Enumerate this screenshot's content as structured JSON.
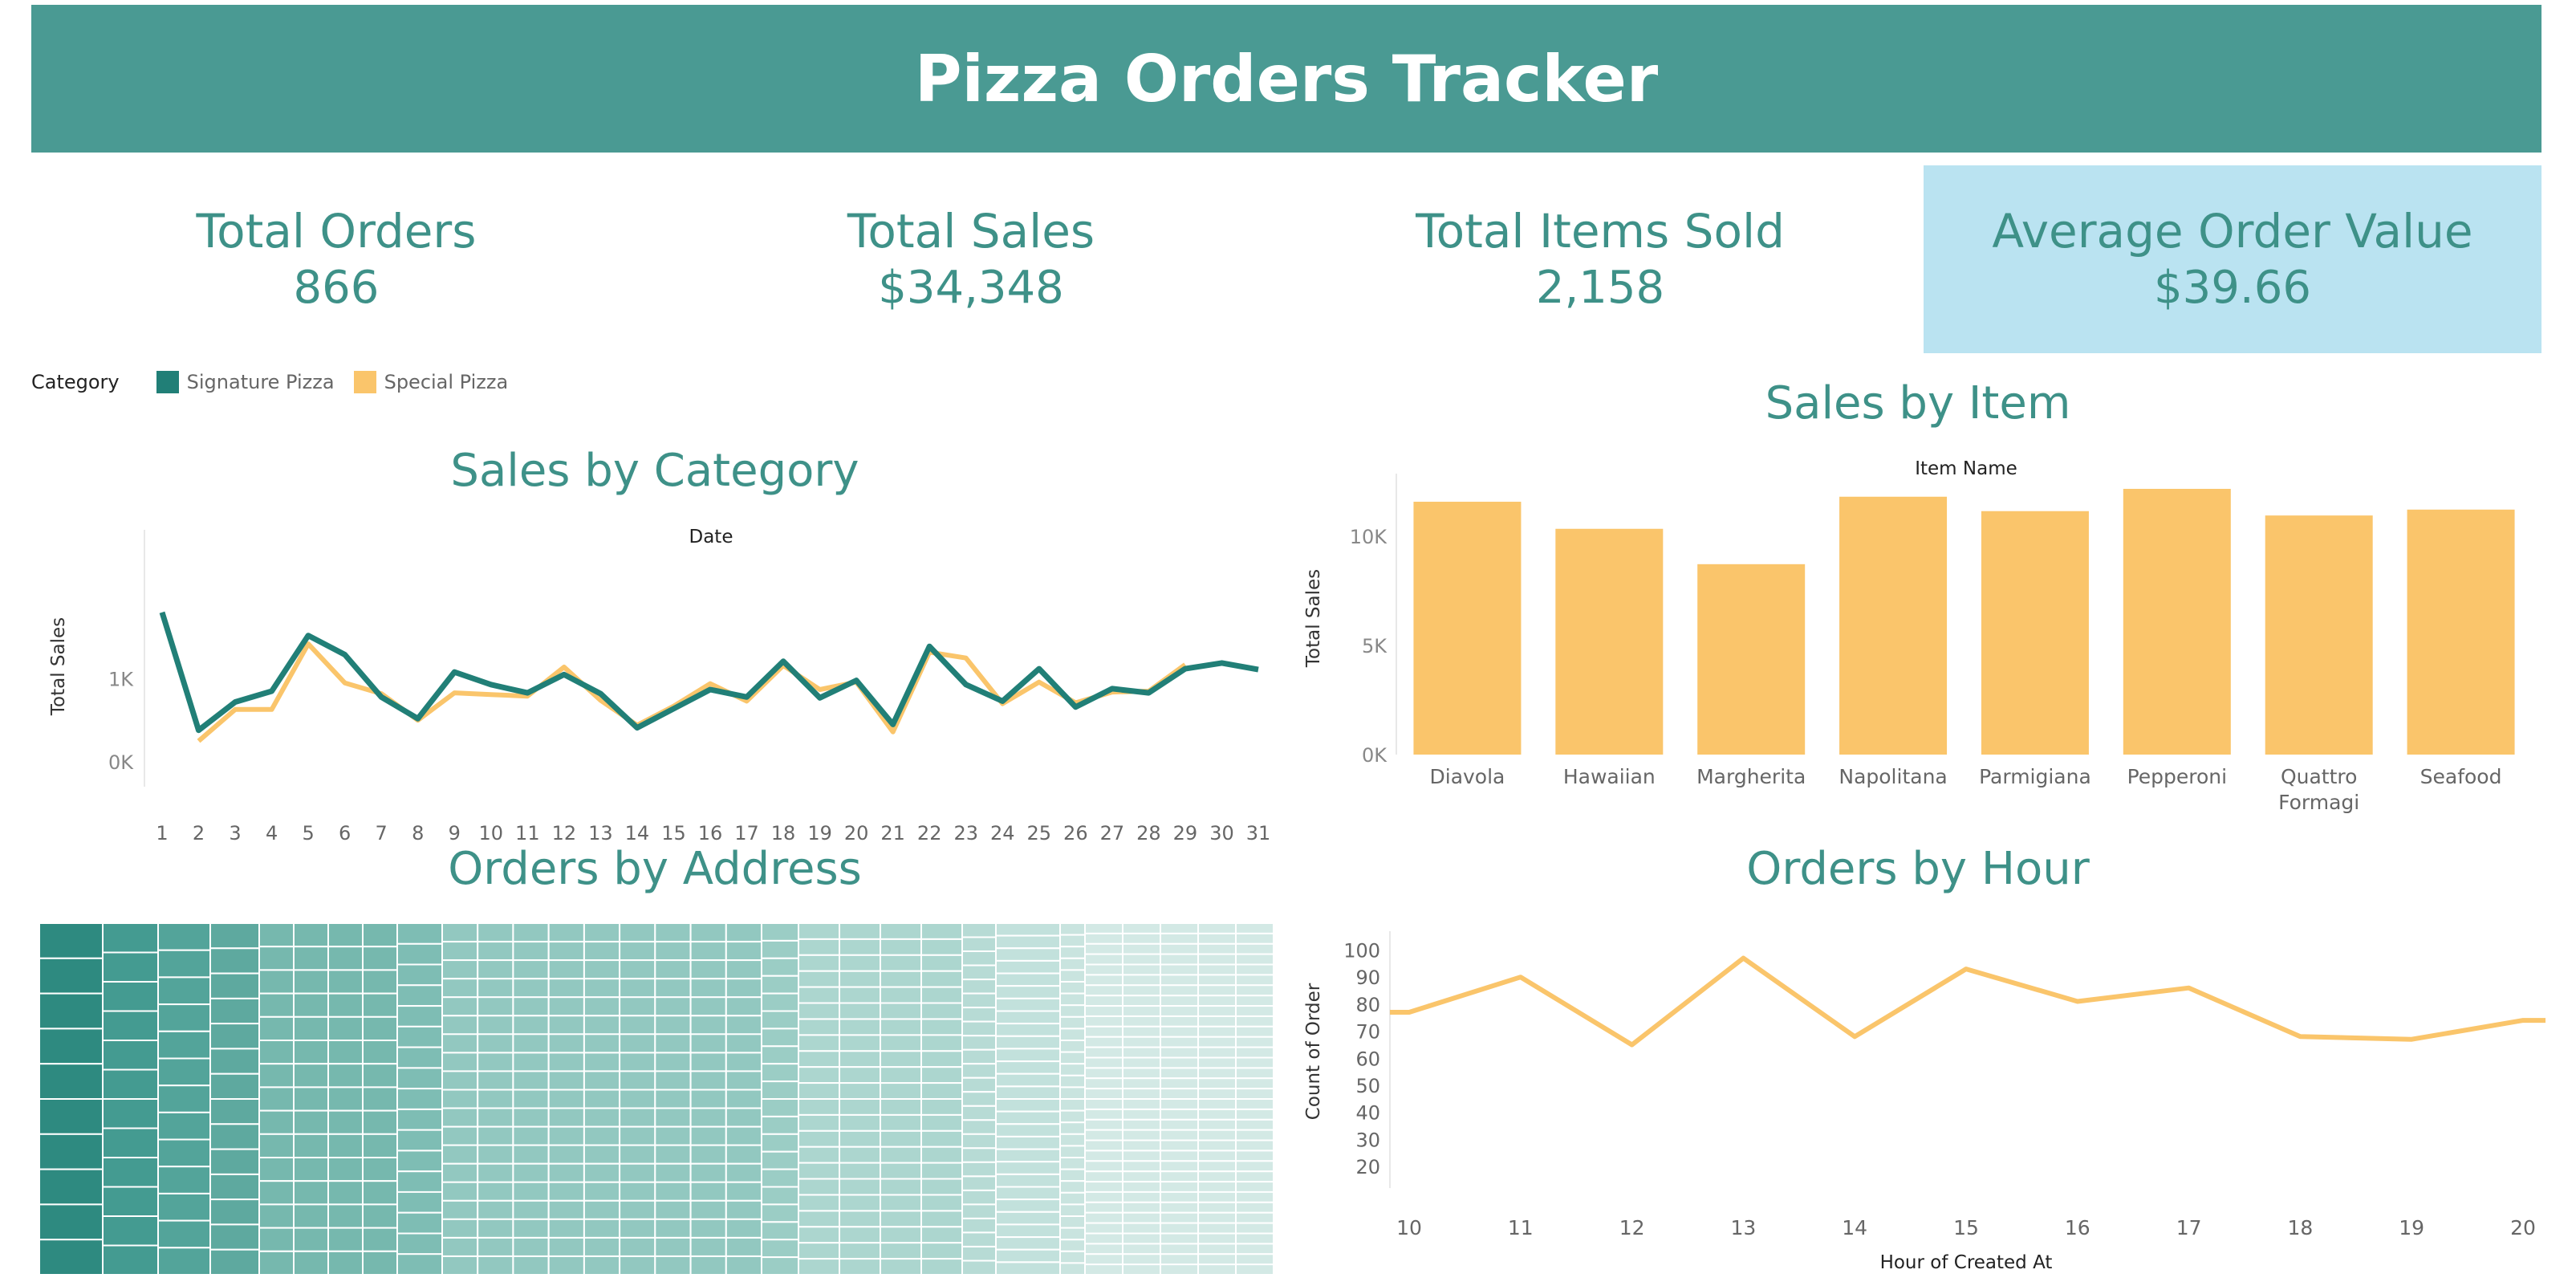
{
  "header": {
    "title": "Pizza Orders Tracker"
  },
  "kpis": [
    {
      "label": "Total Orders",
      "value": "866"
    },
    {
      "label": "Total Sales",
      "value": "$34,348"
    },
    {
      "label": "Total Items Sold",
      "value": "2,158"
    },
    {
      "label": "Average Order Value",
      "value": "$39.66"
    }
  ],
  "colors": {
    "teal": "#217f77",
    "yellow": "#fac56b",
    "title_bar": "#4a9a93",
    "kpi_highlight": "#bae3f1",
    "title_text": "#3e9188"
  },
  "legend": {
    "title": "Category",
    "items": [
      {
        "label": "Signature Pizza",
        "color": "#217f77"
      },
      {
        "label": "Special Pizza",
        "color": "#fac56b"
      }
    ]
  },
  "charts": {
    "category_title": "Sales by Category",
    "item_title": "Sales by Item",
    "address_title": "Orders by Address",
    "hour_title": "Orders by Hour"
  },
  "chart_data": [
    {
      "type": "line",
      "title": "Sales by Category",
      "xlabel": "Date",
      "ylabel": "Total Sales",
      "x": [
        1,
        2,
        3,
        4,
        5,
        6,
        7,
        8,
        9,
        10,
        11,
        12,
        13,
        14,
        15,
        16,
        17,
        18,
        19,
        20,
        21,
        22,
        23,
        24,
        25,
        26,
        27,
        28,
        29,
        30,
        31
      ],
      "y_ticks": [
        "0K",
        "1K"
      ],
      "ylim": [
        -300,
        2600
      ],
      "grid": false,
      "series": [
        {
          "name": "Signature Pizza",
          "color": "#217f77",
          "values": [
            1800,
            380,
            720,
            850,
            1520,
            1290,
            780,
            520,
            1080,
            930,
            830,
            1050,
            820,
            410,
            640,
            870,
            780,
            1210,
            770,
            980,
            450,
            1390,
            930,
            730,
            1120,
            660,
            880,
            830,
            1120,
            1190,
            1110
          ]
        },
        {
          "name": "Special Pizza",
          "color": "#fac56b",
          "values": [
            null,
            250,
            630,
            630,
            1420,
            950,
            820,
            500,
            830,
            810,
            790,
            1140,
            740,
            440,
            670,
            940,
            730,
            1160,
            870,
            960,
            360,
            1320,
            1250,
            700,
            960,
            710,
            840,
            850,
            1170,
            null,
            null
          ]
        }
      ]
    },
    {
      "type": "bar",
      "title": "Sales by Item",
      "xlabel": "Item Name",
      "ylabel": "Total Sales",
      "categories": [
        "Diavola",
        "Hawaiian",
        "Margherita",
        "Napolitana",
        "Parmigiana",
        "Pepperoni",
        "Quattro Formagi",
        "Seafood"
      ],
      "values": [
        11580,
        10340,
        8720,
        11810,
        11150,
        12170,
        10950,
        11220
      ],
      "y_ticks": [
        "0K",
        "5K",
        "10K"
      ],
      "ylim": [
        0,
        12500
      ],
      "color": "#fac56b"
    },
    {
      "type": "heatmap",
      "title": "Orders by Address",
      "note": "treemap of delivery addresses sized and shaded by order count",
      "color": "#217f77"
    },
    {
      "type": "line",
      "title": "Orders by Hour",
      "xlabel": "Hour of Created At",
      "ylabel": "Count of Order",
      "x": [
        10,
        11,
        12,
        13,
        14,
        15,
        16,
        17,
        18,
        19,
        20
      ],
      "values": [
        77,
        90,
        65,
        97,
        68,
        93,
        81,
        86,
        68,
        67,
        74
      ],
      "y_ticks": [
        20,
        30,
        40,
        50,
        60,
        70,
        80,
        90,
        100
      ],
      "ylim": [
        15,
        104
      ],
      "color": "#fac56b"
    }
  ]
}
